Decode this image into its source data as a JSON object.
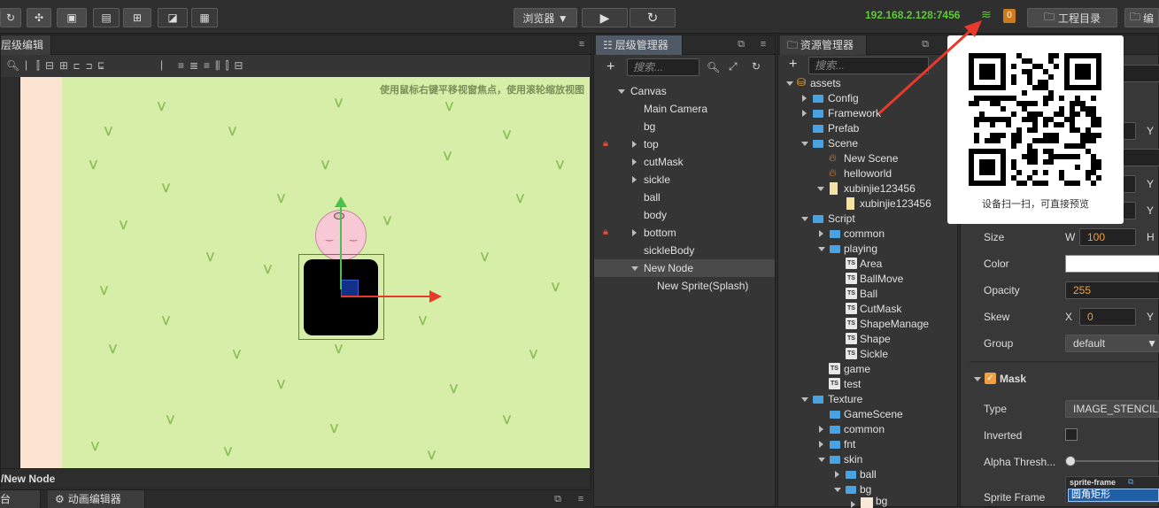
{
  "toolbar": {
    "browser_label": "浏览器 ▼",
    "ip": "192.168.2.128:7456",
    "badge": "0",
    "project_dir_label": "工程目录",
    "right_btn_label": "编"
  },
  "scene": {
    "tab_label": "层级编辑器",
    "hint": "使用鼠标右键平移视窗焦点，使用滚轮缩放视图",
    "status_path": "/New Node"
  },
  "bottom": {
    "tab1": "台",
    "tab2": "动画编辑器"
  },
  "hierarchy": {
    "tab_label": "层级管理器",
    "search_placeholder": "搜索...",
    "items": [
      {
        "label": "Canvas"
      },
      {
        "label": "Main Camera"
      },
      {
        "label": "bg"
      },
      {
        "label": "top"
      },
      {
        "label": "cutMask"
      },
      {
        "label": "sickle"
      },
      {
        "label": "ball"
      },
      {
        "label": "body"
      },
      {
        "label": "bottom"
      },
      {
        "label": "sickleBody"
      },
      {
        "label": "New Node"
      },
      {
        "label": "New Sprite(Splash)"
      }
    ]
  },
  "assets": {
    "tab_label": "资源管理器",
    "search_placeholder": "搜索...",
    "items": [
      {
        "label": "assets"
      },
      {
        "label": "Config"
      },
      {
        "label": "Framework"
      },
      {
        "label": "Prefab"
      },
      {
        "label": "Scene"
      },
      {
        "label": "New Scene"
      },
      {
        "label": "helloworld"
      },
      {
        "label": "xubinjie123456"
      },
      {
        "label": "xubinjie123456"
      },
      {
        "label": "Script"
      },
      {
        "label": "common"
      },
      {
        "label": "playing"
      },
      {
        "label": "Area"
      },
      {
        "label": "BallMove"
      },
      {
        "label": "Ball"
      },
      {
        "label": "CutMask"
      },
      {
        "label": "ShapeManage"
      },
      {
        "label": "Shape"
      },
      {
        "label": "Sickle"
      },
      {
        "label": "game"
      },
      {
        "label": "test"
      },
      {
        "label": "Texture"
      },
      {
        "label": "GameScene"
      },
      {
        "label": "common"
      },
      {
        "label": "fnt"
      },
      {
        "label": "skin"
      },
      {
        "label": "ball"
      },
      {
        "label": "bg"
      },
      {
        "label": "bg"
      }
    ]
  },
  "inspector": {
    "size_label": "Size",
    "size_w_axis": "W",
    "size_w": "100",
    "size_h_axis": "H",
    "color_label": "Color",
    "opacity_label": "Opacity",
    "opacity": "255",
    "skew_label": "Skew",
    "skew_x_axis": "X",
    "skew_x": "0",
    "skew_y_axis": "Y",
    "group_label": "Group",
    "group_value": "default",
    "mask_label": "Mask",
    "type_label": "Type",
    "type_value": "IMAGE_STENCIL",
    "inverted_label": "Inverted",
    "alpha_label": "Alpha Thresh...",
    "sprite_frame_label": "Sprite Frame",
    "sprite_frame_tag": "sprite-frame",
    "sprite_frame_value": "圆角矩形",
    "y_axis": "Y"
  },
  "qr": {
    "caption": "设备扫一扫，可直接预览"
  },
  "colors": {
    "ip_green": "#5fc93b",
    "badge_orange": "#d07a1e",
    "arrow_red": "#e8392b"
  }
}
